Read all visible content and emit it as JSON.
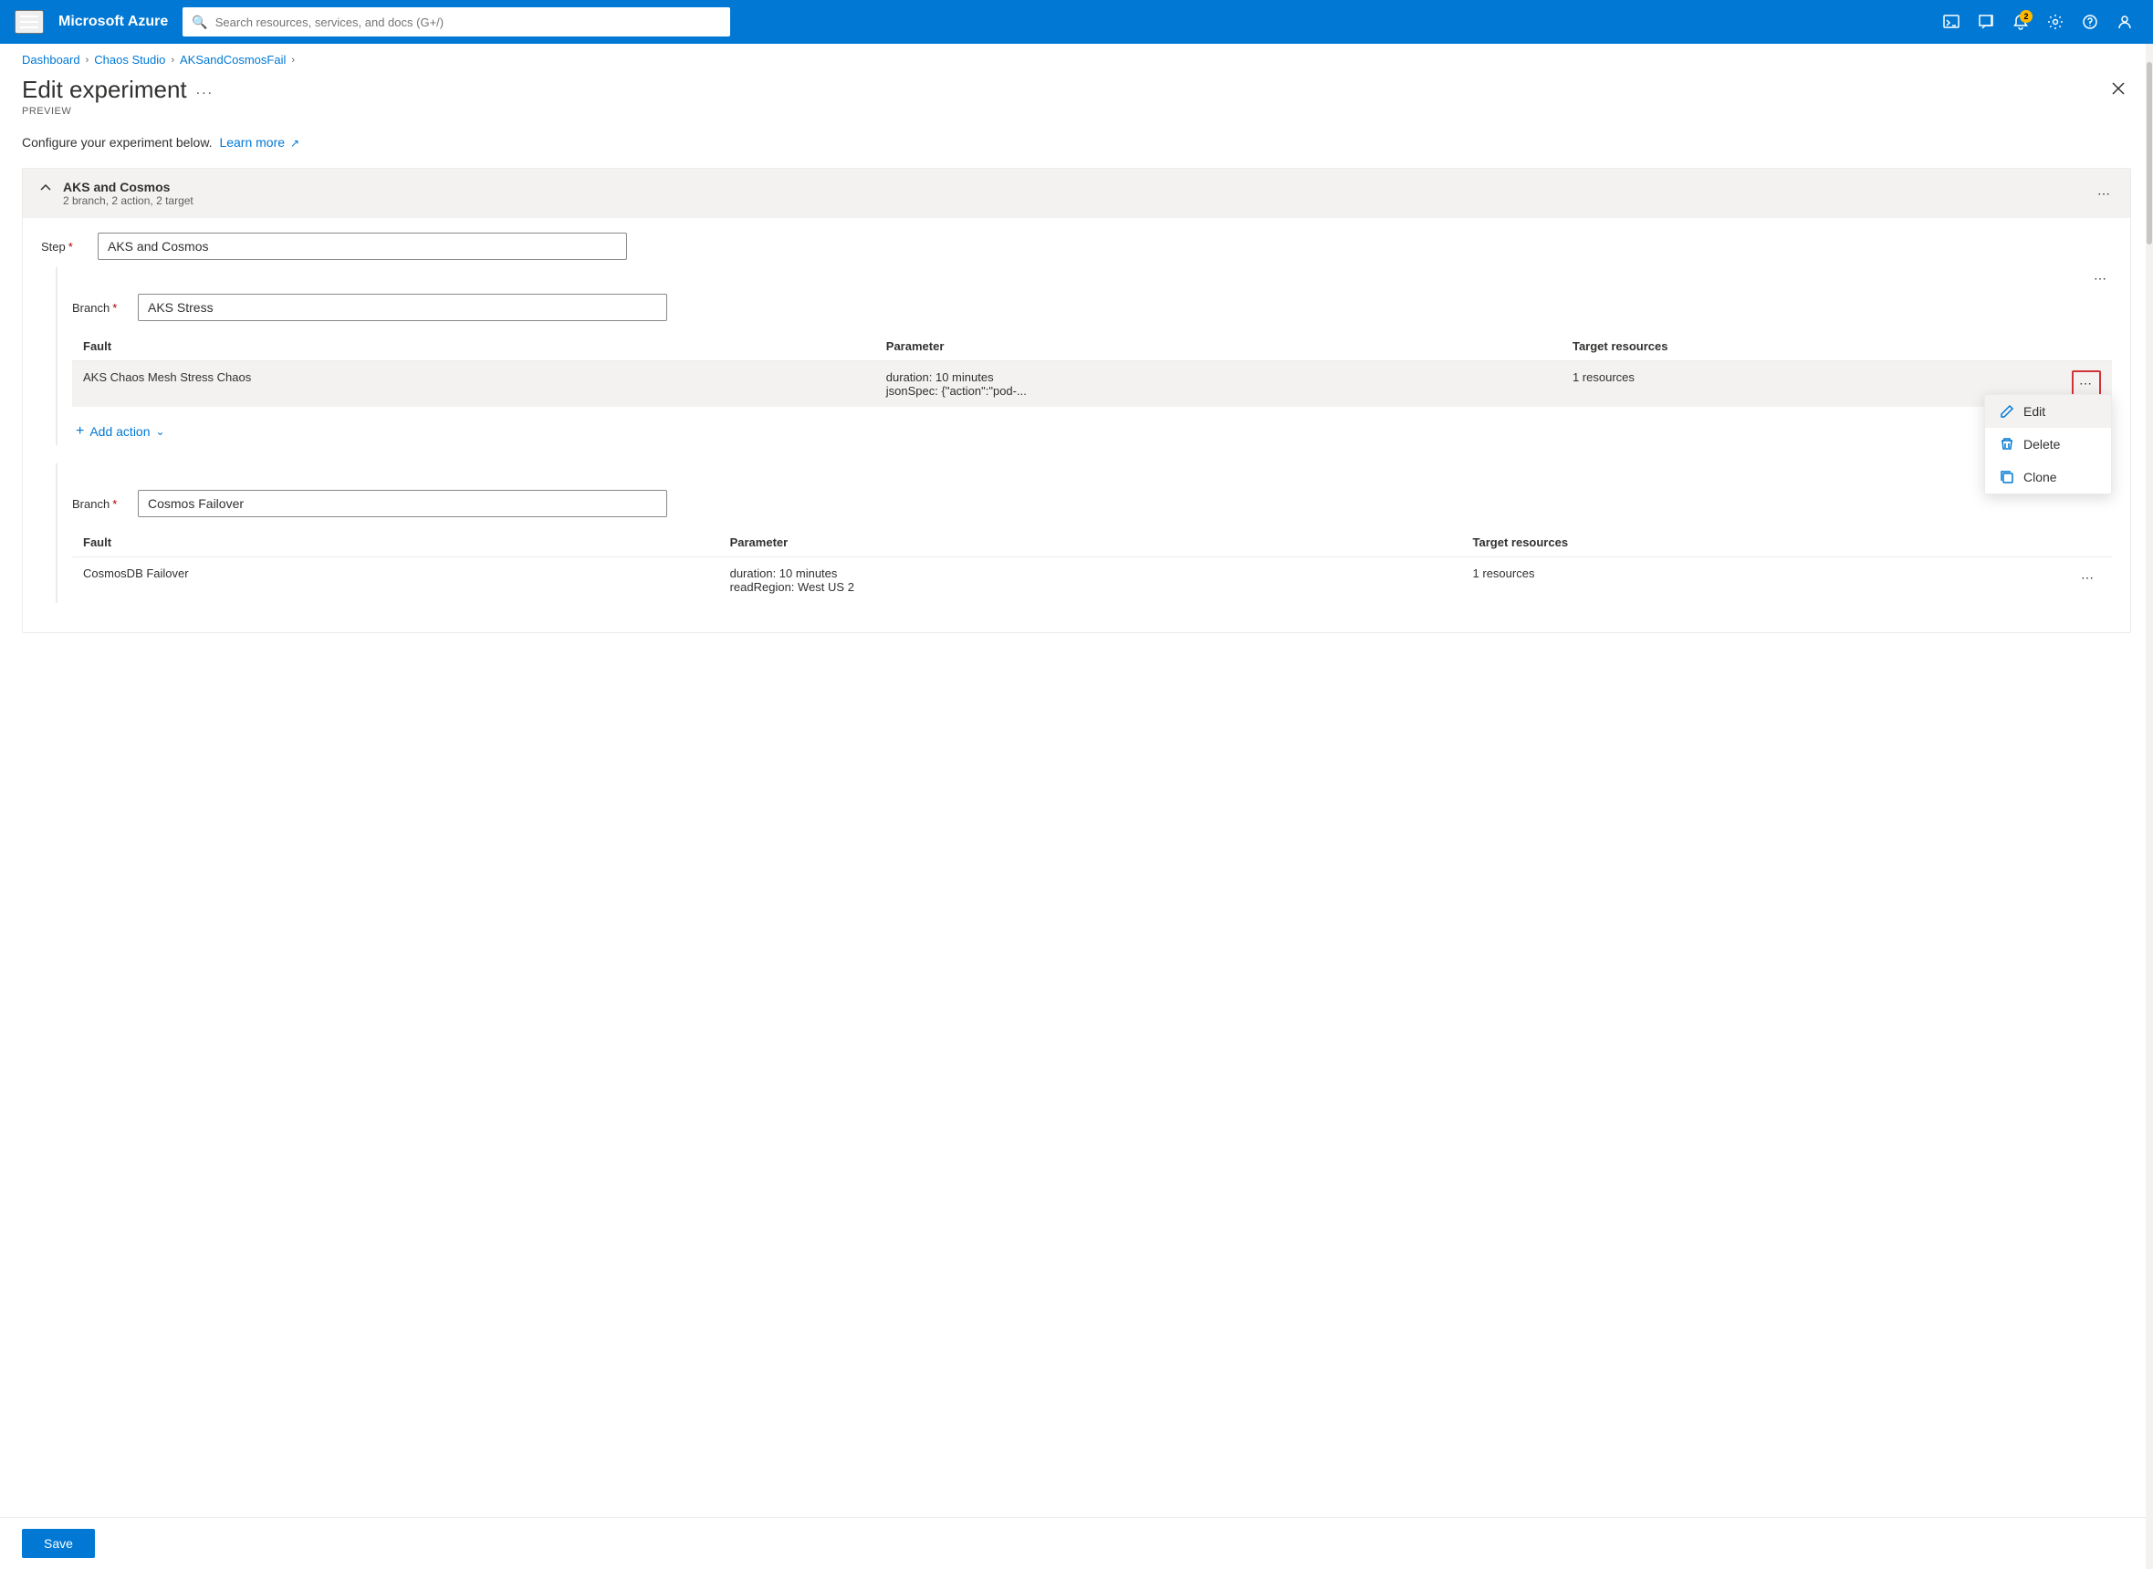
{
  "topbar": {
    "hamburger_label": "Menu",
    "title": "Microsoft Azure",
    "search_placeholder": "Search resources, services, and docs (G+/)",
    "notification_count": "2",
    "icons": [
      "terminal-icon",
      "feedback-icon",
      "notification-icon",
      "settings-icon",
      "help-icon",
      "user-icon"
    ]
  },
  "breadcrumb": {
    "items": [
      "Dashboard",
      "Chaos Studio",
      "AKSandCosmosFail"
    ]
  },
  "page": {
    "title": "Edit experiment",
    "ellipsis": "...",
    "subtitle": "PREVIEW",
    "configure_text": "Configure your experiment below.",
    "learn_more_label": "Learn more"
  },
  "experiment": {
    "section_title": "AKS and Cosmos",
    "section_subtitle": "2 branch, 2 action, 2 target",
    "step_label": "Step",
    "step_value": "AKS and Cosmos",
    "branch1": {
      "label": "Branch",
      "value": "AKS Stress",
      "fault_col": "Fault",
      "param_col": "Parameter",
      "target_col": "Target resources",
      "fault_name": "AKS Chaos Mesh Stress Chaos",
      "fault_param1": "duration: 10 minutes",
      "fault_param2": "jsonSpec: {\"action\":\"pod-...",
      "fault_target": "1 resources",
      "add_action_label": "Add action",
      "context_menu": {
        "edit_label": "Edit",
        "delete_label": "Delete",
        "clone_label": "Clone"
      }
    },
    "branch2": {
      "label": "Branch",
      "value": "Cosmos Failover",
      "fault_col": "Fault",
      "param_col": "Parameter",
      "target_col": "Target resources",
      "fault_name": "CosmosDB Failover",
      "fault_param1": "duration: 10 minutes",
      "fault_param2": "readRegion: West US 2",
      "fault_target": "1 resources"
    }
  },
  "footer": {
    "save_label": "Save"
  }
}
